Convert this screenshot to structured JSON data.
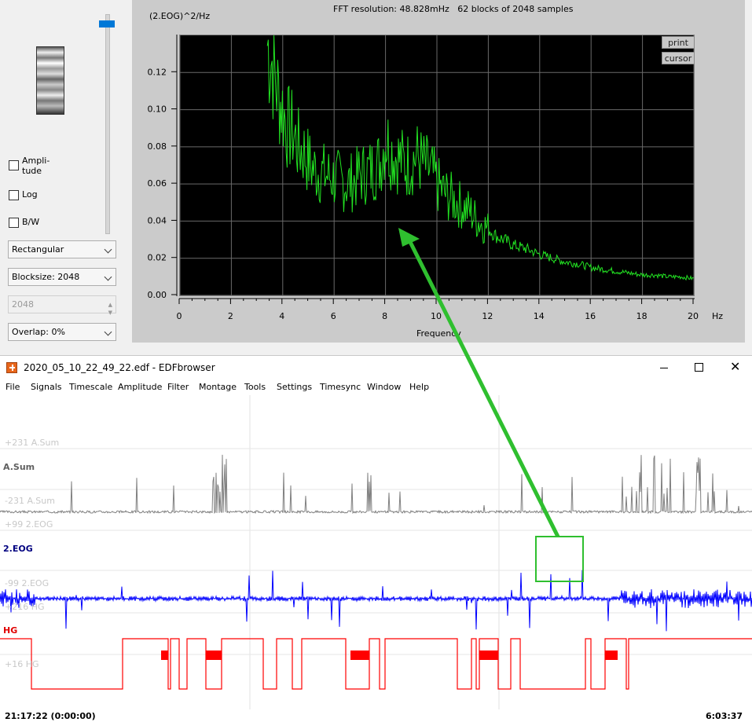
{
  "fft": {
    "header": "FFT resolution: 48.828mHz   62 blocks of 2048 samples",
    "ylabel": "(2.EOG)^2/Hz",
    "xlabel": "Frequency",
    "xunit": "Hz",
    "print_label": "print",
    "cursor_label": "cursor",
    "options": {
      "amplitude": "Ampli-\ntude",
      "log": "Log",
      "bw": "B/W"
    },
    "window_select": "Rectangular",
    "blocksize_select": "Blocksize: 2048",
    "blocksize_spin": "2048",
    "overlap_select": "Overlap: 0%",
    "colors": {
      "trace": "#22e322",
      "background": "#000000",
      "grid": "#6a6a6a"
    }
  },
  "chart_data": {
    "type": "line",
    "xlabel": "Frequency",
    "ylabel": "(2.EOG)^2/Hz",
    "xlim": [
      0,
      20
    ],
    "ylim": [
      0,
      0.14
    ],
    "xticks": [
      "0",
      "2",
      "4",
      "6",
      "8",
      "10",
      "12",
      "14",
      "16",
      "18",
      "20"
    ],
    "yticks": [
      "0.00",
      "0.02",
      "0.04",
      "0.06",
      "0.08",
      "0.10",
      "0.12"
    ],
    "grid": true,
    "series": [
      {
        "x": [
          3.4,
          3.6,
          3.8,
          4.0,
          4.2,
          4.4,
          4.6,
          4.8,
          5.0,
          5.2,
          5.5,
          5.8,
          6.0,
          6.2,
          6.5,
          6.8,
          7.0,
          7.2,
          7.5,
          7.8,
          8.0,
          8.2,
          8.5,
          8.8,
          9.0,
          9.2,
          9.5,
          9.8,
          10.0,
          10.3,
          10.6,
          11.0,
          11.3,
          11.6,
          12.0,
          12.3,
          12.6,
          13.0,
          13.5,
          14.0,
          14.5,
          15.0,
          15.5,
          16.0,
          16.5,
          17.0,
          17.5,
          18.0,
          18.5,
          19.0,
          19.5,
          20.0
        ],
        "values": [
          0.135,
          0.125,
          0.11,
          0.1,
          0.09,
          0.088,
          0.08,
          0.078,
          0.072,
          0.068,
          0.066,
          0.064,
          0.063,
          0.062,
          0.06,
          0.062,
          0.065,
          0.066,
          0.068,
          0.072,
          0.085,
          0.078,
          0.074,
          0.07,
          0.072,
          0.075,
          0.07,
          0.066,
          0.06,
          0.055,
          0.052,
          0.048,
          0.045,
          0.04,
          0.036,
          0.032,
          0.03,
          0.027,
          0.025,
          0.022,
          0.02,
          0.018,
          0.017,
          0.015,
          0.014,
          0.013,
          0.012,
          0.011,
          0.011,
          0.01,
          0.01,
          0.009
        ]
      }
    ]
  },
  "edf": {
    "title": "2020_05_10_22_49_22.edf - EDFbrowser",
    "menu": [
      "File",
      "Signals",
      "Timescale",
      "Amplitude",
      "Filter",
      "Montage",
      "Tools",
      "Settings",
      "Timesync",
      "Window",
      "Help"
    ],
    "signals": {
      "asum": {
        "name": "A.Sum",
        "top": "+231 A.Sum",
        "bottom": "-231 A.Sum",
        "color": "#808080"
      },
      "eog": {
        "name": "2.EOG",
        "top": "+99 2.EOG",
        "bottom": "-99 2.EOG",
        "color": "#0000ff"
      },
      "hg": {
        "name": "HG",
        "top": "+216 HG",
        "mid": "+16 HG",
        "color": "#ff0000"
      }
    },
    "time_start": "21:17:22 (0:00:00)",
    "time_end": "6:03:37",
    "annotation_color": "#2fbf2f"
  }
}
